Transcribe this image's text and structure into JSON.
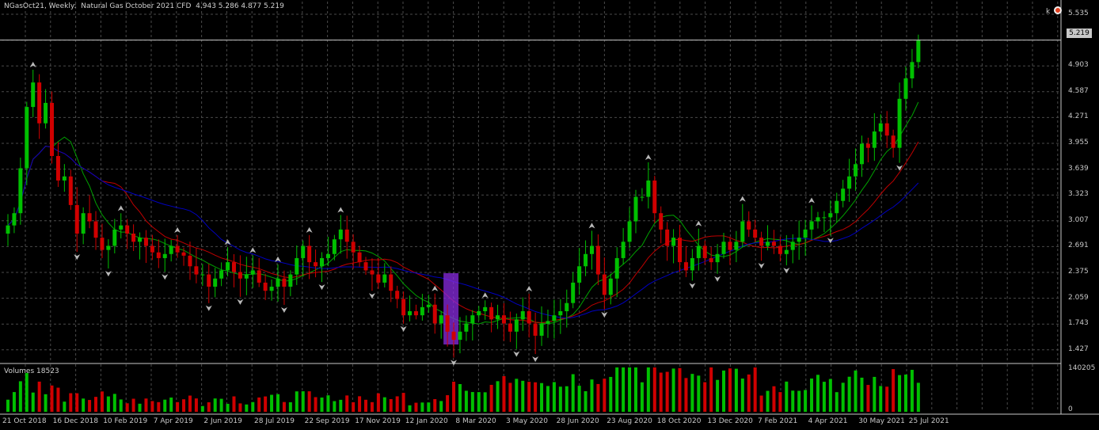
{
  "header": {
    "symbol": "NGasOct21",
    "timeframe": "Weekly",
    "description": "Natural Gas October 2021 CFD",
    "ohlc": "4.943 5.286 4.877 5.219"
  },
  "volume_panel": {
    "label": "Volumes 18523",
    "axis_top": "140205",
    "axis_bottom": "0"
  },
  "current_price": "5.219",
  "price_axis": [
    "5.535",
    "5.219",
    "4.903",
    "4.587",
    "4.271",
    "3.955",
    "3.639",
    "3.323",
    "3.007",
    "2.691",
    "2.375",
    "2.059",
    "1.743",
    "1.427"
  ],
  "time_axis": [
    "21 Oct 2018",
    "16 Dec 2018",
    "10 Feb 2019",
    "7 Apr 2019",
    "2 Jun 2019",
    "28 Jul 2019",
    "22 Sep 2019",
    "17 Nov 2019",
    "12 Jan 2020",
    "8 Mar 2020",
    "3 May 2020",
    "28 Jun 2020",
    "23 Aug 2020",
    "18 Oct 2020",
    "13 Dec 2020",
    "7 Feb 2021",
    "4 Apr 2021",
    "30 May 2021",
    "25 Jul 2021"
  ],
  "colors": {
    "bull": "#00c000",
    "bear": "#d00000",
    "grid": "#4a4a4a",
    "ma_fast": "#00a000",
    "ma_mid": "#c00000",
    "ma_slow": "#0000c0",
    "highlight": "#8a2be2"
  },
  "icons": {
    "corner": "chart-settings-icon",
    "fractal": "fractal-arrow-icon"
  },
  "chart_data": {
    "type": "candlestick",
    "ylim": [
      1.27,
      5.69
    ],
    "closes": [
      2.95,
      3.1,
      3.65,
      4.4,
      4.7,
      4.2,
      4.45,
      3.8,
      3.5,
      3.55,
      3.2,
      2.85,
      3.1,
      3.0,
      2.8,
      2.65,
      2.7,
      2.9,
      2.95,
      2.85,
      2.75,
      2.8,
      2.7,
      2.62,
      2.55,
      2.6,
      2.7,
      2.62,
      2.58,
      2.45,
      2.35,
      2.35,
      2.2,
      2.3,
      2.4,
      2.5,
      2.38,
      2.3,
      2.35,
      2.4,
      2.25,
      2.15,
      2.2,
      2.3,
      2.2,
      2.35,
      2.55,
      2.7,
      2.5,
      2.45,
      2.55,
      2.6,
      2.78,
      2.9,
      2.75,
      2.62,
      2.5,
      2.4,
      2.35,
      2.25,
      2.35,
      2.15,
      2.05,
      1.85,
      1.9,
      1.85,
      1.95,
      1.98,
      1.75,
      1.85,
      1.65,
      1.55,
      1.65,
      1.75,
      1.85,
      1.9,
      1.95,
      1.8,
      1.85,
      1.75,
      1.65,
      1.8,
      1.9,
      1.75,
      1.6,
      1.75,
      1.78,
      1.85,
      1.9,
      2.0,
      2.25,
      2.45,
      2.6,
      2.7,
      2.35,
      2.1,
      2.3,
      2.55,
      2.75,
      3.0,
      3.3,
      3.3,
      3.5,
      3.1,
      2.9,
      2.7,
      2.8,
      2.5,
      2.4,
      2.55,
      2.7,
      2.55,
      2.5,
      2.6,
      2.75,
      2.65,
      2.75,
      3.0,
      2.9,
      2.8,
      2.7,
      2.75,
      2.7,
      2.6,
      2.65,
      2.75,
      2.8,
      2.9,
      3.0,
      3.05,
      3.05,
      3.1,
      3.25,
      3.4,
      3.55,
      3.7,
      3.95,
      3.9,
      4.1,
      4.2,
      4.05,
      3.9,
      4.5,
      4.75,
      4.95,
      5.22
    ]
  }
}
